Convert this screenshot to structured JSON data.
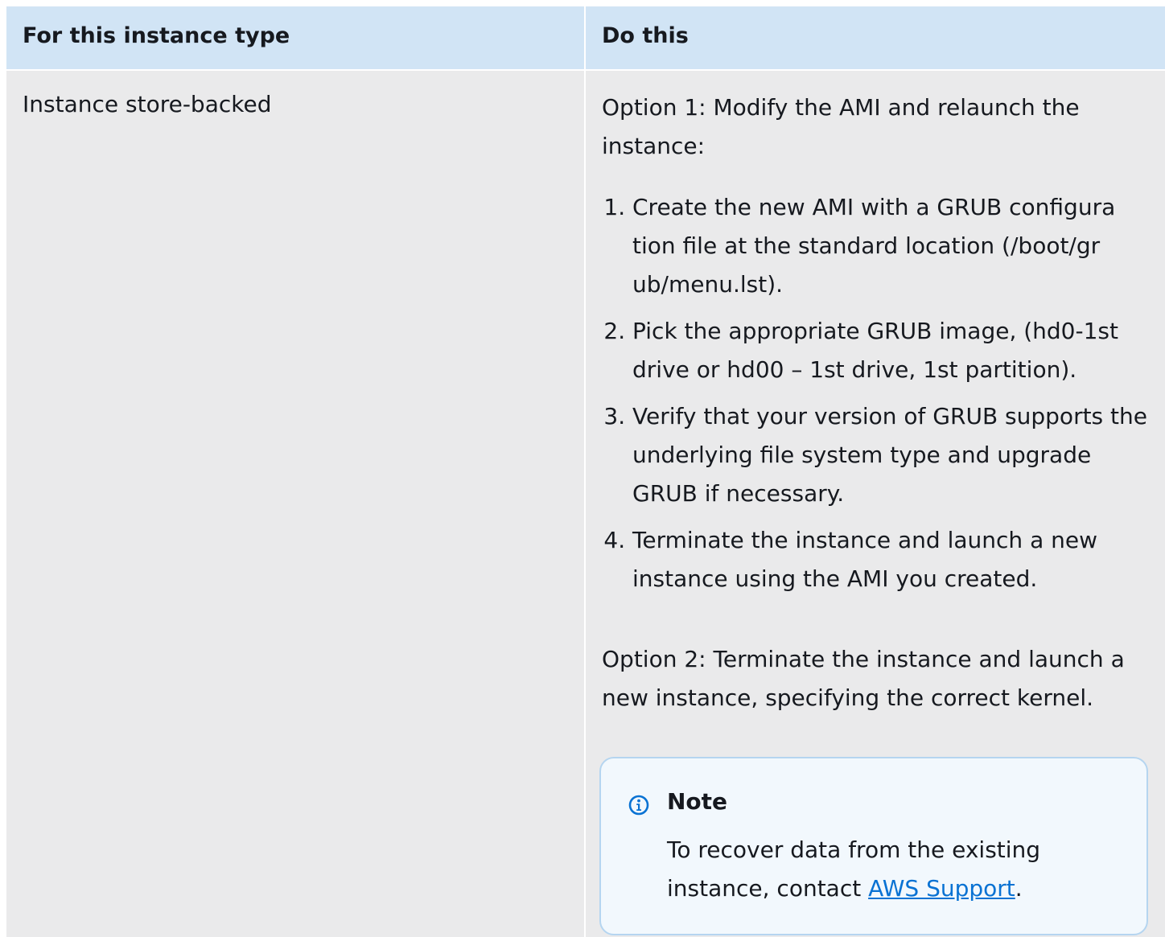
{
  "table": {
    "headers": [
      "For this instance type",
      "Do this"
    ],
    "row": {
      "instance_type": "Instance store-backed",
      "option1": "Option 1: Modify the AMI and relaunch the instance:",
      "steps": [
        "Create the new AMI with a GRUB configura tion file at the standard location (/boot/gr ub/menu.lst).",
        "Pick the appropriate GRUB image, (hd0-1st drive or hd00 – 1st drive, 1st partition).",
        "Verify that your version of GRUB supports the underlying file system type and upgrade GRUB if necessary.",
        "Terminate the instance and launch a new instance using the AMI you created."
      ],
      "option2": "Option 2: Terminate the instance and launch a new instance, specifying the correct kernel.",
      "note": {
        "icon": "info-icon",
        "title": "Note",
        "text_before": "To recover data from the existing instance, contact ",
        "link": "AWS Support",
        "text_after": "."
      }
    }
  },
  "colors": {
    "header_bg": "#d1e4f5",
    "row_bg": "#eaeaeb",
    "note_bg": "#f2f8fd",
    "note_border": "#b5d5f0",
    "link": "#0972d3",
    "info_icon": "#0972d3"
  }
}
